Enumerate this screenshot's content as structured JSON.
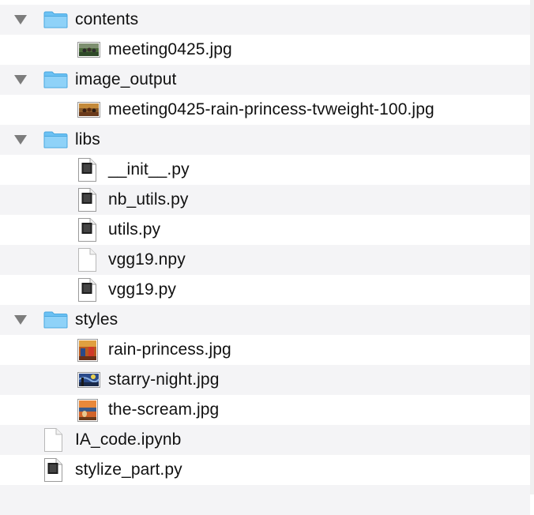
{
  "items": [
    {
      "label": "contents",
      "type": "folder",
      "expanded": true,
      "icon": "folder-icon"
    },
    {
      "label": "meeting0425.jpg",
      "type": "image",
      "icon": "jpg-thumbnail-icon"
    },
    {
      "label": "image_output",
      "type": "folder",
      "expanded": true,
      "icon": "folder-icon"
    },
    {
      "label": "meeting0425-rain-princess-tvweight-100.jpg",
      "type": "image",
      "icon": "jpg-thumbnail-icon"
    },
    {
      "label": "libs",
      "type": "folder",
      "expanded": true,
      "icon": "folder-icon"
    },
    {
      "label": "__init__.py",
      "type": "python",
      "icon": "python-file-icon",
      "icon_badge": "PYTHON"
    },
    {
      "label": "nb_utils.py",
      "type": "python",
      "icon": "python-file-icon",
      "icon_badge": "PYTHON"
    },
    {
      "label": "utils.py",
      "type": "python",
      "icon": "python-file-icon",
      "icon_badge": "PYTHON"
    },
    {
      "label": "vgg19.npy",
      "type": "file",
      "icon": "blank-document-icon"
    },
    {
      "label": "vgg19.py",
      "type": "python",
      "icon": "python-file-icon",
      "icon_badge": "PYTHON"
    },
    {
      "label": "styles",
      "type": "folder",
      "expanded": true,
      "icon": "folder-icon"
    },
    {
      "label": "rain-princess.jpg",
      "type": "image",
      "icon": "painting-thumbnail-icon"
    },
    {
      "label": "starry-night.jpg",
      "type": "image",
      "icon": "painting-thumbnail-icon"
    },
    {
      "label": "the-scream.jpg",
      "type": "image",
      "icon": "painting-thumbnail-icon"
    },
    {
      "label": "IA_code.ipynb",
      "type": "file",
      "icon": "blank-document-icon"
    },
    {
      "label": "stylize_part.py",
      "type": "python",
      "icon": "python-file-icon",
      "icon_badge": "PYTHON"
    }
  ],
  "colors": {
    "folder": "#5ab8f0",
    "folder_tab": "#7ccaf5",
    "stripe": "#f4f4f6",
    "disclosure": "#7c7c7c"
  }
}
